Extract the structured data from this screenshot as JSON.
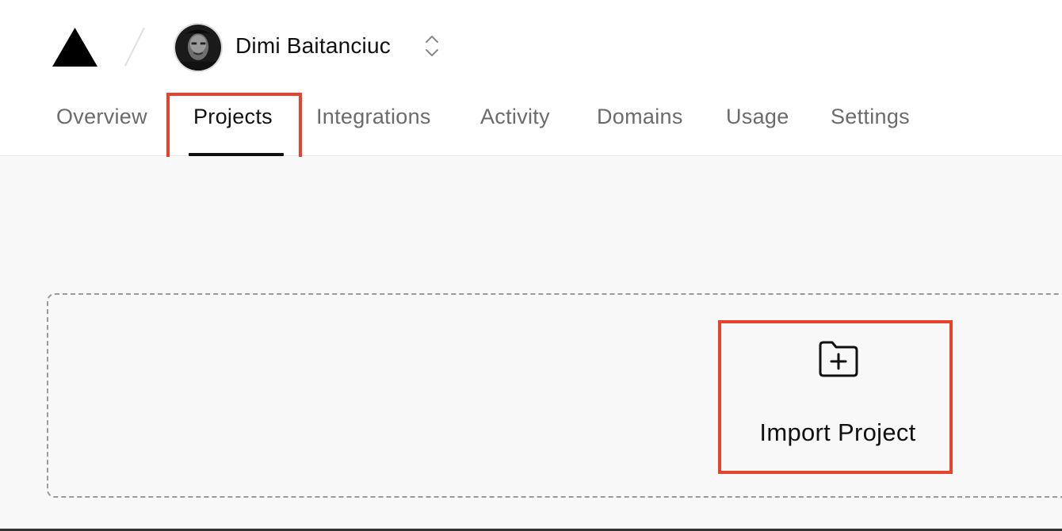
{
  "header": {
    "account_name": "Dimi Baitanciuc",
    "icons": {
      "logo": "triangle-logo-icon",
      "switcher": "chevron-up-down-icon",
      "avatar": "user-avatar"
    }
  },
  "tabs": [
    {
      "label": "Overview",
      "active": false
    },
    {
      "label": "Projects",
      "active": true
    },
    {
      "label": "Integrations",
      "active": false
    },
    {
      "label": "Activity",
      "active": false
    },
    {
      "label": "Domains",
      "active": false
    },
    {
      "label": "Usage",
      "active": false
    },
    {
      "label": "Settings",
      "active": false
    }
  ],
  "main": {
    "import_label": "Import Project",
    "import_icon": "folder-plus-icon"
  },
  "colors": {
    "highlight": "#e5432e",
    "text_primary": "#111111",
    "text_secondary": "#6b6b6b",
    "background": "#f8f8f8"
  }
}
